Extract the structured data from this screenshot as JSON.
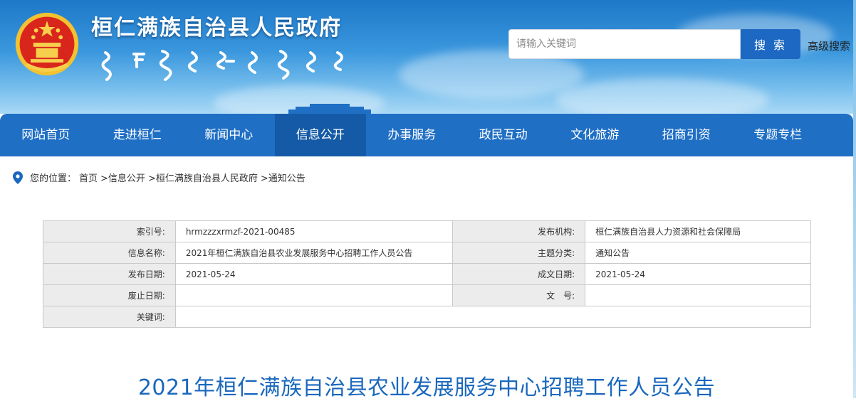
{
  "header": {
    "site_title": "桓仁满族自治县人民政府",
    "search": {
      "placeholder": "请输入关键词",
      "button_label": "搜 索",
      "advanced_label": "高级搜索"
    }
  },
  "nav": {
    "items": [
      "网站首页",
      "走进桓仁",
      "新闻中心",
      "信息公开",
      "办事服务",
      "政民互动",
      "文化旅游",
      "招商引资",
      "专题专栏"
    ],
    "active_index": 3
  },
  "breadcrumb": {
    "prefix": "您的位置：",
    "items": [
      "首页",
      ">信息公开",
      ">桓仁满族自治县人民政府",
      ">通知公告"
    ]
  },
  "meta": {
    "rows": [
      {
        "l1": "索引号:",
        "v1": "hrmzzzxrmzf-2021-00485",
        "l2": "发布机构:",
        "v2": "桓仁满族自治县人力资源和社会保障局"
      },
      {
        "l1": "信息名称:",
        "v1": "2021年桓仁满族自治县农业发展服务中心招聘工作人员公告",
        "l2": "主题分类:",
        "v2": "通知公告"
      },
      {
        "l1": "发布日期:",
        "v1": "2021-05-24",
        "l2": "成文日期:",
        "v2": "2021-05-24"
      },
      {
        "l1": "废止日期:",
        "v1": "",
        "l2": "文　号:",
        "v2": ""
      },
      {
        "l1": "关键词:",
        "v1": ""
      }
    ]
  },
  "article": {
    "title": "2021年桓仁满族自治县农业发展服务中心招聘工作人员公告"
  },
  "colors": {
    "nav_bg": "#1f6fc5",
    "nav_active": "#155aa6",
    "title_blue": "#1a68bd",
    "search_btn": "#1d68c2"
  }
}
